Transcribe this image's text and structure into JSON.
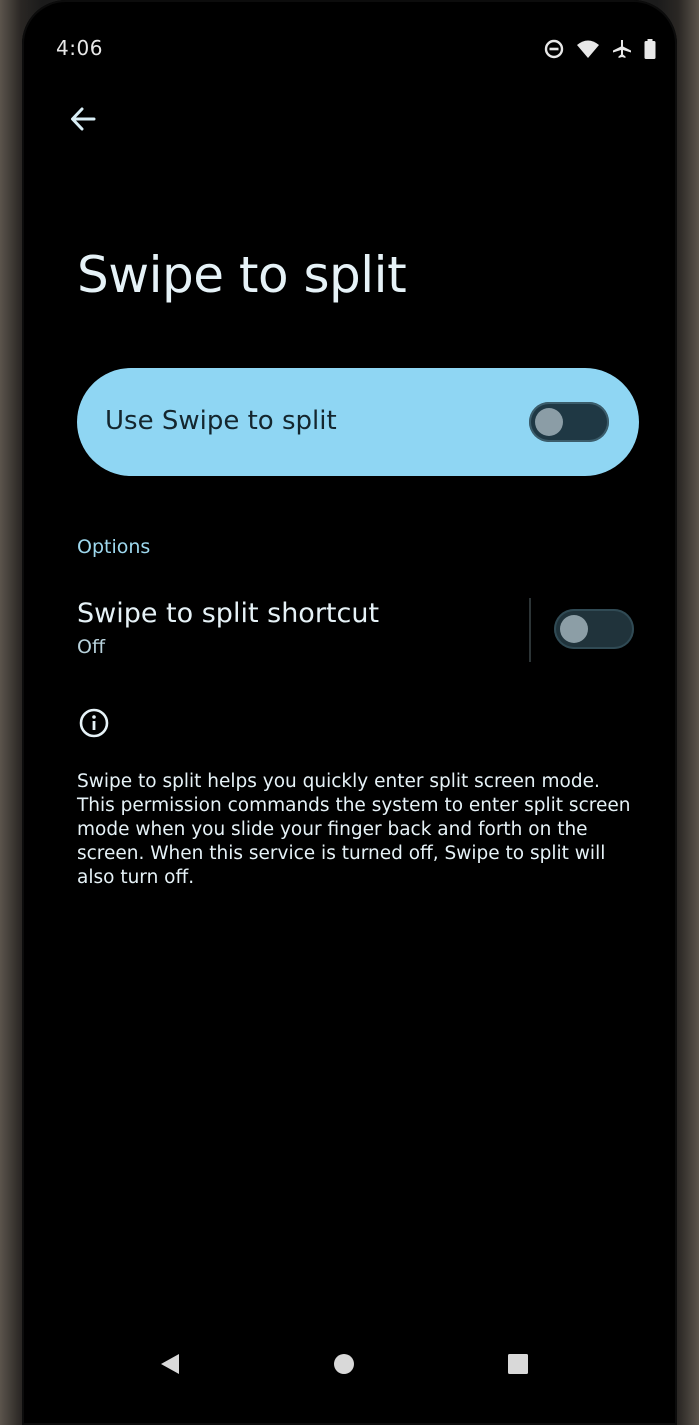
{
  "status_bar": {
    "time": "4:06",
    "icons": [
      "do-not-disturb-icon",
      "wifi-icon",
      "airplane-icon",
      "battery-icon"
    ]
  },
  "toolbar": {
    "back_icon": "arrow-left-icon"
  },
  "page": {
    "title": "Swipe to split"
  },
  "main_switch": {
    "label": "Use Swipe to split",
    "checked": false,
    "card_color": "#8fd6f3"
  },
  "options": {
    "header": "Options",
    "shortcut": {
      "title": "Swipe to split shortcut",
      "summary": "Off",
      "checked": false
    }
  },
  "info": {
    "icon": "info-icon",
    "text": "Swipe to split helps you quickly enter split screen mode. This permission commands the system to enter split screen mode when you slide your finger back and forth on the screen. When this service is turned off, Swipe to split will also turn off."
  },
  "nav_bar": {
    "icons": [
      "back-triangle-icon",
      "home-circle-icon",
      "recents-square-icon"
    ]
  },
  "colors": {
    "background": "#000000",
    "accent": "#8fd6f3",
    "title_text": "#e6f2f7",
    "section_header": "#9ed8ee"
  }
}
